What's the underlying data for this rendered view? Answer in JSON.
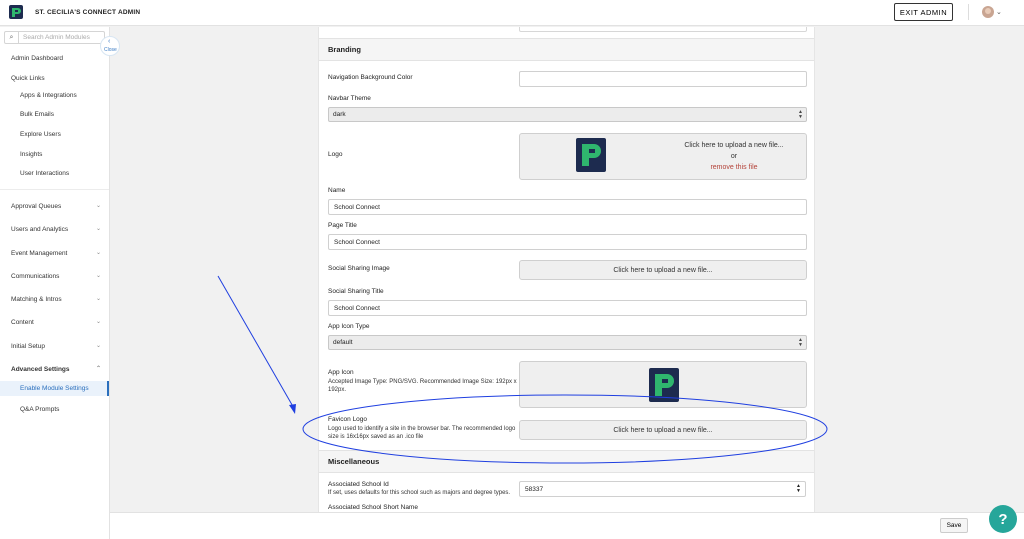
{
  "app": {
    "title": "ST. CECILIA'S CONNECT ADMIN",
    "exit_label": "EXIT ADMIN"
  },
  "sidebar": {
    "search_placeholder": "Search Admin Modules",
    "close_label": "Close",
    "dashboard": "Admin Dashboard",
    "quick_links": "Quick Links",
    "quick_items": [
      "Apps & Integrations",
      "Bulk Emails",
      "Explore Users",
      "Insights",
      "User Interactions"
    ],
    "groups": [
      "Approval Queues",
      "Users and Analytics",
      "Event Management",
      "Communications",
      "Matching & Intros",
      "Content",
      "Initial Setup"
    ],
    "advanced": "Advanced Settings",
    "advanced_items": [
      "Enable Module Settings",
      "Q&A Prompts"
    ]
  },
  "branding": {
    "header": "Branding",
    "nav_bg_label": "Navigation Background Color",
    "nav_bg_value": "",
    "navbar_theme_label": "Navbar Theme",
    "navbar_theme_value": "dark",
    "logo_label": "Logo",
    "upload_prompt": "Click here to upload a new file...",
    "or": "or",
    "remove": "remove this file",
    "name_label": "Name",
    "name_value": "School Connect",
    "page_title_label": "Page Title",
    "page_title_value": "School Connect",
    "sharing_image_label": "Social Sharing Image",
    "sharing_title_label": "Social Sharing Title",
    "sharing_title_value": "School Connect",
    "app_icon_type_label": "App Icon Type",
    "app_icon_type_value": "default",
    "app_icon_label": "App Icon",
    "app_icon_desc": "Accepted Image Type: PNG/SVG. Recommended Image Size: 192px x 192px.",
    "favicon_label": "Favicon Logo",
    "favicon_desc": "Logo used to identify a site in the browser bar. The recommended logo size is 16x16px saved as an .ico file"
  },
  "misc": {
    "header": "Miscellaneous",
    "school_id_label": "Associated School Id",
    "school_id_desc": "If set, uses defaults for this school such as majors and degree types.",
    "school_id_value": "58337",
    "short_name_label": "Associated School Short Name"
  },
  "footer": {
    "save": "Save",
    "help": "?"
  },
  "colors": {
    "accent": "#2a6fbd",
    "help": "#26a69a",
    "annotation": "#1f3fe0",
    "logo_green": "#2fb66e",
    "logo_navy": "#1d2b4f"
  }
}
